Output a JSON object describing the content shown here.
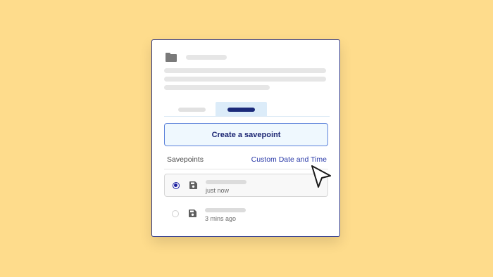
{
  "panel": {
    "icon": "folder-icon",
    "create_button_label": "Create a savepoint",
    "savepoints_label": "Savepoints",
    "custom_link_label": "Custom Date and Time"
  },
  "savepoints": [
    {
      "time": "just now",
      "selected": true,
      "icon": "save-icon"
    },
    {
      "time": "3 mins ago",
      "selected": false,
      "icon": "save-icon"
    }
  ],
  "colors": {
    "background": "#fedc8c",
    "accent": "#1b2a7a",
    "link": "#2a3aa8",
    "button_border": "#5c82da"
  },
  "pointer": "cursor-arrow-icon"
}
